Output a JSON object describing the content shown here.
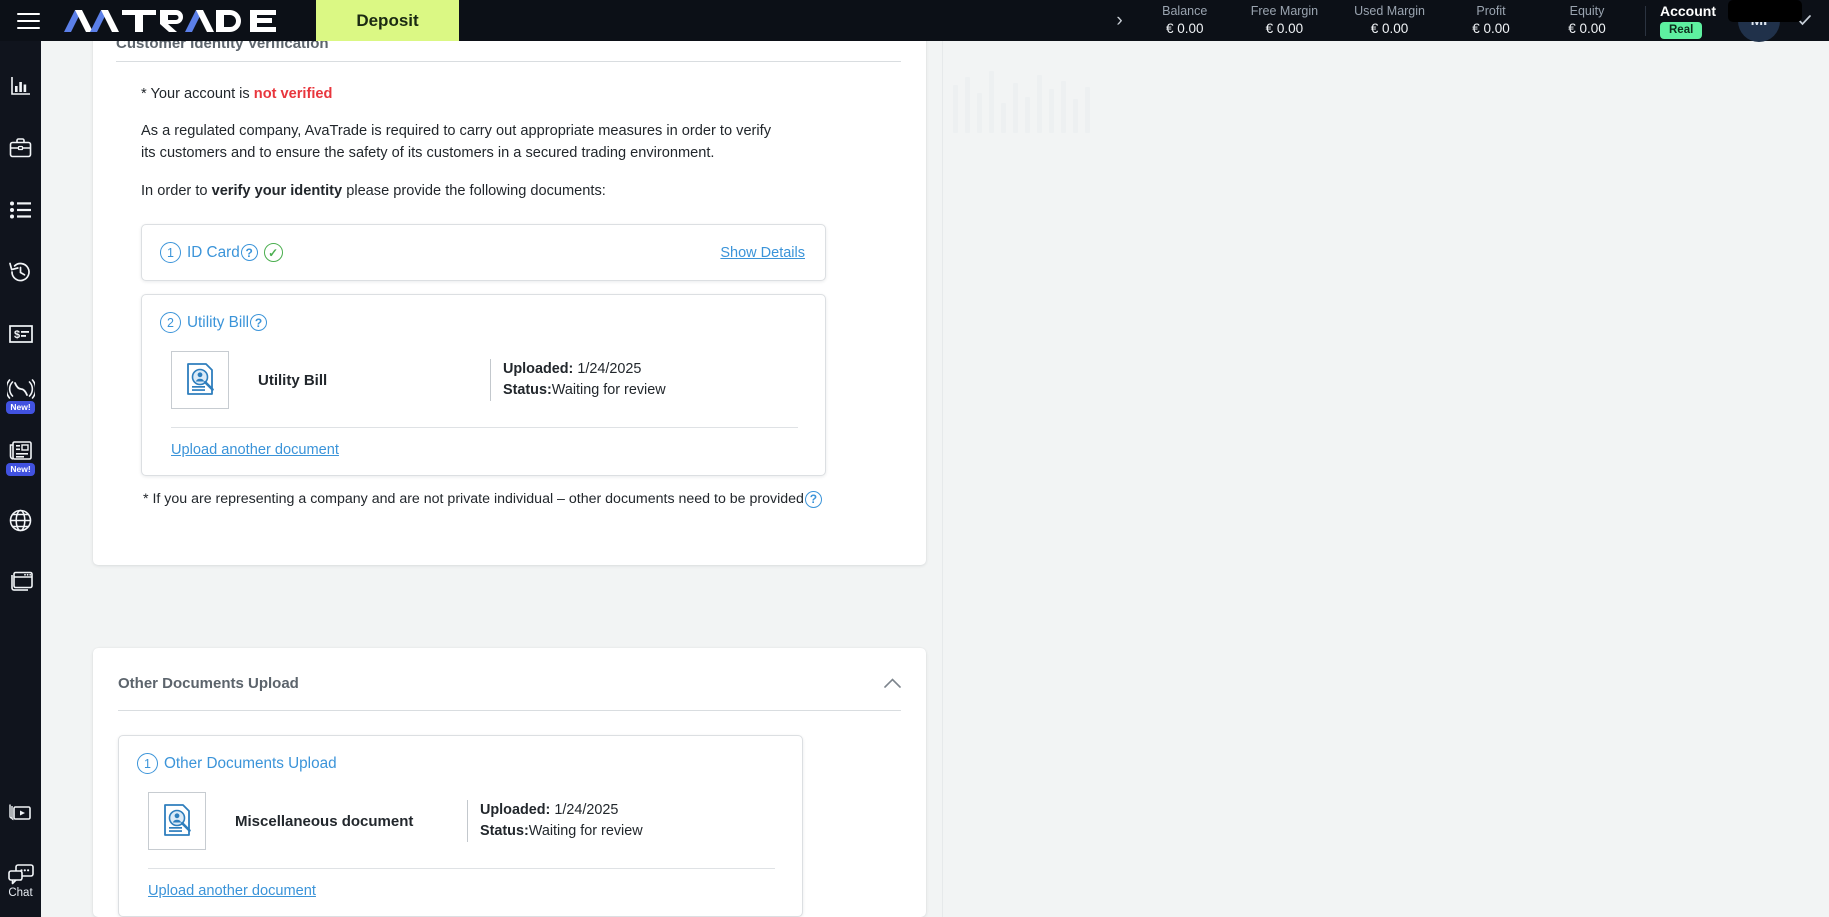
{
  "header": {
    "logo_text": "AVATRADE",
    "deposit_label": "Deposit",
    "expand_chevron": "›",
    "metrics": [
      {
        "label": "Balance",
        "value": "€ 0.00"
      },
      {
        "label": "Free Margin",
        "value": "€ 0.00"
      },
      {
        "label": "Used Margin",
        "value": "€ 0.00"
      },
      {
        "label": "Profit",
        "value": "€ 0.00"
      },
      {
        "label": "Equity",
        "value": "€ 0.00"
      }
    ],
    "account_title": "Account",
    "account_badge": "Real",
    "avatar_initials": "MI",
    "chevron_down": "⌄"
  },
  "sidebar": {
    "items": [
      {
        "name": "chart-icon",
        "badge": ""
      },
      {
        "name": "portfolio-icon",
        "badge": ""
      },
      {
        "name": "list-icon",
        "badge": ""
      },
      {
        "name": "history-icon",
        "badge": ""
      },
      {
        "name": "payments-icon",
        "badge": ""
      },
      {
        "name": "signals-icon",
        "badge": "New!"
      },
      {
        "name": "news-icon",
        "badge": "New!"
      },
      {
        "name": "globe-icon",
        "badge": ""
      },
      {
        "name": "window-icon",
        "badge": ""
      }
    ],
    "video_icon": "video-icon",
    "chat_label": "Chat"
  },
  "verification_card": {
    "title": "Customer Identity Verification",
    "notice_prefix": "* Your account is ",
    "notice_status": "not verified",
    "paragraph": "As a regulated company, AvaTrade is required to carry out appropriate measures in order to verify its customers and to ensure the safety of its customers in a secured trading environment.",
    "instruction_prefix": "In order to ",
    "instruction_bold": "verify your identity",
    "instruction_suffix": " please provide the following documents:",
    "steps": [
      {
        "number": "1",
        "label": "ID Card",
        "help": "?",
        "verified_check": "✓",
        "show_details_label": "Show Details"
      },
      {
        "number": "2",
        "label": "Utility Bill",
        "help": "?",
        "document": {
          "name": "Utility Bill",
          "uploaded_label": "Uploaded:",
          "uploaded_value": " 1/24/2025",
          "status_label": "Status:",
          "status_value": "Waiting for review"
        },
        "upload_another_label": "Upload another document"
      }
    ],
    "footnote": "* If you are representing a company and are not private individual – other documents need to be provided",
    "footnote_help": "?"
  },
  "other_documents_card": {
    "title": "Other Documents Upload",
    "collapse_chevron": "˄",
    "step": {
      "number": "1",
      "label": "Other Documents Upload",
      "document": {
        "name": "Miscellaneous document",
        "uploaded_label": "Uploaded:",
        "uploaded_value": " 1/24/2025",
        "status_label": "Status:",
        "status_value": "Waiting for review"
      },
      "upload_another_label": "Upload another document"
    }
  },
  "colors": {
    "header_bg": "#0c1017",
    "sidebar_bg": "#10141d",
    "deposit_green": "#dbf884",
    "real_badge_green": "#5ef0a0",
    "link_blue": "#3b94d9",
    "error_red": "#e8363d",
    "check_green": "#4caf50",
    "new_badge_blue": "#4152e0",
    "page_bg": "#f2f4f4"
  }
}
